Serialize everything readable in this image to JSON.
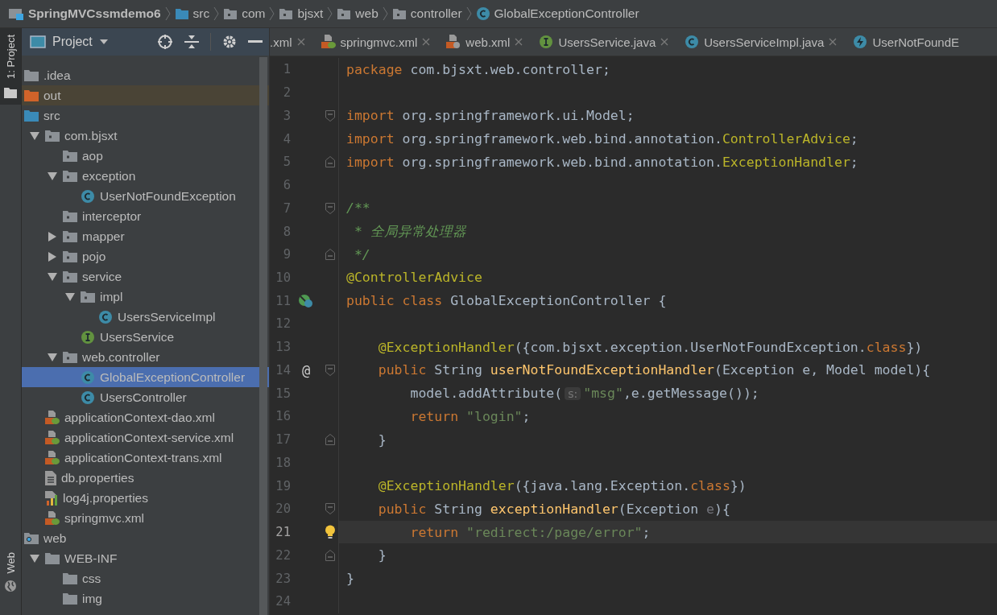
{
  "breadcrumb": [
    {
      "label": "SpringMVCssmdemo6",
      "kind": "project"
    },
    {
      "label": "src",
      "kind": "source"
    },
    {
      "label": "com",
      "kind": "package"
    },
    {
      "label": "bjsxt",
      "kind": "package"
    },
    {
      "label": "web",
      "kind": "package"
    },
    {
      "label": "controller",
      "kind": "package"
    },
    {
      "label": "GlobalExceptionController",
      "kind": "class"
    }
  ],
  "tool_strip": {
    "top": "1: Project",
    "bottom": "Web"
  },
  "project_panel": {
    "title": "Project",
    "tree": [
      {
        "label": ".idea",
        "kind": "folder",
        "selected": false
      },
      {
        "label": "out",
        "kind": "excluded",
        "selected": false
      },
      {
        "label": "src",
        "kind": "source",
        "selected": false,
        "children": [
          {
            "label": "com.bjsxt",
            "kind": "package",
            "expanded": true,
            "selected": false,
            "children": [
              {
                "label": "aop",
                "kind": "package",
                "selected": false
              },
              {
                "label": "exception",
                "kind": "package",
                "expanded": true,
                "selected": false,
                "children": [
                  {
                    "label": "UserNotFoundException",
                    "kind": "class",
                    "selected": false
                  }
                ]
              },
              {
                "label": "interceptor",
                "kind": "package",
                "selected": false
              },
              {
                "label": "mapper",
                "kind": "package",
                "expanded": false,
                "selected": false
              },
              {
                "label": "pojo",
                "kind": "package",
                "expanded": false,
                "selected": false
              },
              {
                "label": "service",
                "kind": "package",
                "expanded": true,
                "selected": false,
                "children": [
                  {
                    "label": "impl",
                    "kind": "package",
                    "expanded": true,
                    "selected": false,
                    "children": [
                      {
                        "label": "UsersServiceImpl",
                        "kind": "class",
                        "selected": false
                      }
                    ]
                  },
                  {
                    "label": "UsersService",
                    "kind": "interface",
                    "selected": false
                  }
                ]
              },
              {
                "label": "web.controller",
                "kind": "package",
                "expanded": true,
                "selected": false,
                "children": [
                  {
                    "label": "GlobalExceptionController",
                    "kind": "class",
                    "selected": true
                  },
                  {
                    "label": "UsersController",
                    "kind": "class",
                    "selected": false
                  }
                ]
              }
            ]
          },
          {
            "label": "applicationContext-dao.xml",
            "kind": "spring-xml",
            "selected": false
          },
          {
            "label": "applicationContext-service.xml",
            "kind": "spring-xml",
            "selected": false
          },
          {
            "label": "applicationContext-trans.xml",
            "kind": "spring-xml",
            "selected": false
          },
          {
            "label": "db.properties",
            "kind": "properties",
            "selected": false
          },
          {
            "label": "log4j.properties",
            "kind": "log-properties",
            "selected": false
          },
          {
            "label": "springmvc.xml",
            "kind": "spring-xml",
            "selected": false
          }
        ]
      },
      {
        "label": "web",
        "kind": "web",
        "selected": false,
        "children": [
          {
            "label": "WEB-INF",
            "kind": "folder",
            "expanded": true,
            "selected": false,
            "children": [
              {
                "label": "css",
                "kind": "folder",
                "selected": false
              },
              {
                "label": "img",
                "kind": "folder",
                "selected": false
              }
            ]
          }
        ]
      }
    ]
  },
  "tabs": [
    {
      "label": ".xml",
      "kind": "plain",
      "selected": false
    },
    {
      "label": "springmvc.xml",
      "kind": "spring-xml",
      "selected": false
    },
    {
      "label": "web.xml",
      "kind": "web-xml",
      "selected": false
    },
    {
      "label": "UsersService.java",
      "kind": "interface",
      "selected": false
    },
    {
      "label": "UsersServiceImpl.java",
      "kind": "class",
      "selected": false
    },
    {
      "label": "UserNotFoundE",
      "kind": "exception",
      "selected": false
    }
  ],
  "code": [
    {
      "number": "1",
      "current": false,
      "tokens": [
        {
          "kind": "keyword",
          "text": "package"
        },
        {
          "kind": "plain",
          "text": " com.bjsxt.web.controller;"
        }
      ]
    },
    {
      "number": "2",
      "current": false
    },
    {
      "number": "3",
      "current": false,
      "markers": [
        {
          "kind": "fold-start"
        }
      ],
      "tokens": [
        {
          "kind": "keyword",
          "text": "import"
        },
        {
          "kind": "plain",
          "text": " org.springframework.ui.Model;"
        }
      ]
    },
    {
      "number": "4",
      "current": false,
      "tokens": [
        {
          "kind": "keyword",
          "text": "import"
        },
        {
          "kind": "plain",
          "text": " org.springframework.web.bind.annotation."
        },
        {
          "kind": "annotation",
          "text": "ControllerAdvice"
        },
        {
          "kind": "plain",
          "text": ";"
        }
      ]
    },
    {
      "number": "5",
      "current": false,
      "markers": [
        {
          "kind": "fold-end"
        }
      ],
      "tokens": [
        {
          "kind": "keyword",
          "text": "import"
        },
        {
          "kind": "plain",
          "text": " org.springframework.web.bind.annotation."
        },
        {
          "kind": "annotation",
          "text": "ExceptionHandler"
        },
        {
          "kind": "plain",
          "text": ";"
        }
      ]
    },
    {
      "number": "6",
      "current": false
    },
    {
      "number": "7",
      "current": false,
      "markers": [
        {
          "kind": "fold-start"
        }
      ],
      "tokens": [
        {
          "kind": "comment",
          "text": "/**"
        }
      ]
    },
    {
      "number": "8",
      "current": false,
      "tokens": [
        {
          "kind": "comment",
          "text": " * 全局异常处理器"
        }
      ]
    },
    {
      "number": "9",
      "current": false,
      "markers": [
        {
          "kind": "fold-end"
        }
      ],
      "tokens": [
        {
          "kind": "comment",
          "text": " */"
        }
      ]
    },
    {
      "number": "10",
      "current": false,
      "tokens": [
        {
          "kind": "annotation",
          "text": "@ControllerAdvice"
        }
      ]
    },
    {
      "number": "11",
      "current": false,
      "markers": [
        {
          "kind": "bean"
        }
      ],
      "tokens": [
        {
          "kind": "keyword",
          "text": "public class"
        },
        {
          "kind": "plain",
          "text": " GlobalExceptionController {"
        }
      ]
    },
    {
      "number": "12",
      "current": false
    },
    {
      "number": "13",
      "current": false,
      "tokens": [
        {
          "kind": "annotation",
          "text": "    @ExceptionHandler"
        },
        {
          "kind": "plain",
          "text": "({com.bjsxt.exception.UserNotFoundException."
        },
        {
          "kind": "keyword",
          "text": "class"
        },
        {
          "kind": "plain",
          "text": "})"
        }
      ]
    },
    {
      "number": "14",
      "current": false,
      "gutter_mark": "@",
      "markers": [
        {
          "kind": "fold-start"
        }
      ],
      "tokens": [
        {
          "kind": "keyword",
          "text": "    public"
        },
        {
          "kind": "plain",
          "text": " String "
        },
        {
          "kind": "method",
          "text": "userNotFoundExceptionHandler"
        },
        {
          "kind": "plain",
          "text": "(Exception e, Model model){"
        }
      ]
    },
    {
      "number": "15",
      "current": false,
      "tokens": [
        {
          "kind": "plain",
          "text": "        model.addAttribute("
        },
        {
          "kind": "hint",
          "text": "s:"
        },
        {
          "kind": "string",
          "text": "\"msg\""
        },
        {
          "kind": "plain",
          "text": ",e.getMessage());"
        }
      ]
    },
    {
      "number": "16",
      "current": false,
      "tokens": [
        {
          "kind": "keyword",
          "text": "        return"
        },
        {
          "kind": "string",
          "text": " \"login\""
        },
        {
          "kind": "plain",
          "text": ";"
        }
      ]
    },
    {
      "number": "17",
      "current": false,
      "markers": [
        {
          "kind": "fold-end"
        }
      ],
      "tokens": [
        {
          "kind": "plain",
          "text": "    }"
        }
      ]
    },
    {
      "number": "18",
      "current": false
    },
    {
      "number": "19",
      "current": false,
      "tokens": [
        {
          "kind": "annotation",
          "text": "    @ExceptionHandler"
        },
        {
          "kind": "plain",
          "text": "({java.lang.Exception."
        },
        {
          "kind": "keyword",
          "text": "class"
        },
        {
          "kind": "plain",
          "text": "})"
        }
      ]
    },
    {
      "number": "20",
      "current": false,
      "markers": [
        {
          "kind": "fold-start"
        }
      ],
      "tokens": [
        {
          "kind": "keyword",
          "text": "    public"
        },
        {
          "kind": "plain",
          "text": " String "
        },
        {
          "kind": "method",
          "text": "exceptionHandler"
        },
        {
          "kind": "plain",
          "text": "(Exception "
        },
        {
          "kind": "unused",
          "text": "e"
        },
        {
          "kind": "plain",
          "text": "){"
        }
      ]
    },
    {
      "number": "21",
      "current": true,
      "markers": [
        {
          "kind": "bulb"
        }
      ],
      "tokens": [
        {
          "kind": "keyword",
          "text": "        return"
        },
        {
          "kind": "string",
          "text": " \"redirect:/page/error\""
        },
        {
          "kind": "plain",
          "text": ";"
        }
      ]
    },
    {
      "number": "22",
      "current": false,
      "markers": [
        {
          "kind": "fold-end"
        }
      ],
      "tokens": [
        {
          "kind": "plain",
          "text": "    }"
        }
      ]
    },
    {
      "number": "23",
      "current": false,
      "tokens": [
        {
          "kind": "plain",
          "text": "}"
        }
      ]
    },
    {
      "number": "24",
      "current": false
    }
  ]
}
